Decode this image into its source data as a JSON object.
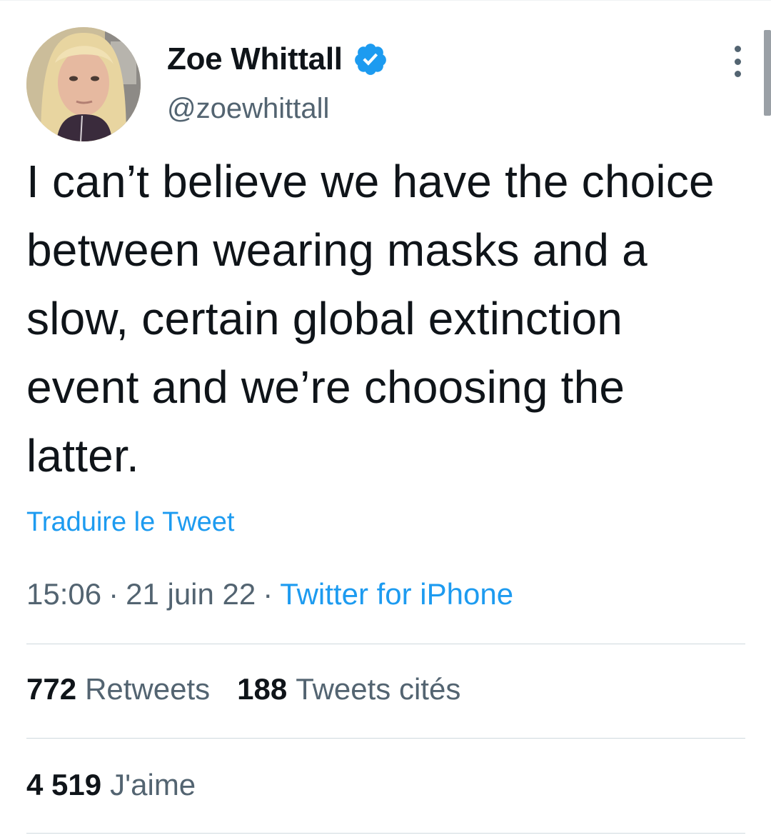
{
  "author": {
    "display_name": "Zoe Whittall",
    "handle": "@zoewhittall",
    "avatar_icon": "profile-photo",
    "verified_icon": "verified-badge-icon"
  },
  "tweet": {
    "text": "I can’t believe we have the choice between wearing masks and a slow, certain global extinction event and we’re choosing the latter.",
    "translate_label": "Traduire le Tweet"
  },
  "meta": {
    "time": "15:06",
    "separator": "·",
    "date": "21 juin 22",
    "source": "Twitter for iPhone"
  },
  "stats": {
    "retweets_count": "772",
    "retweets_label": "Retweets",
    "quotes_count": "188",
    "quotes_label": "Tweets cités",
    "likes_count": "4 519",
    "likes_label": "J'aime"
  },
  "colors": {
    "accent": "#1d9bf0",
    "text_primary": "#0f1419",
    "text_secondary": "#536471",
    "divider": "#cfd9de"
  }
}
